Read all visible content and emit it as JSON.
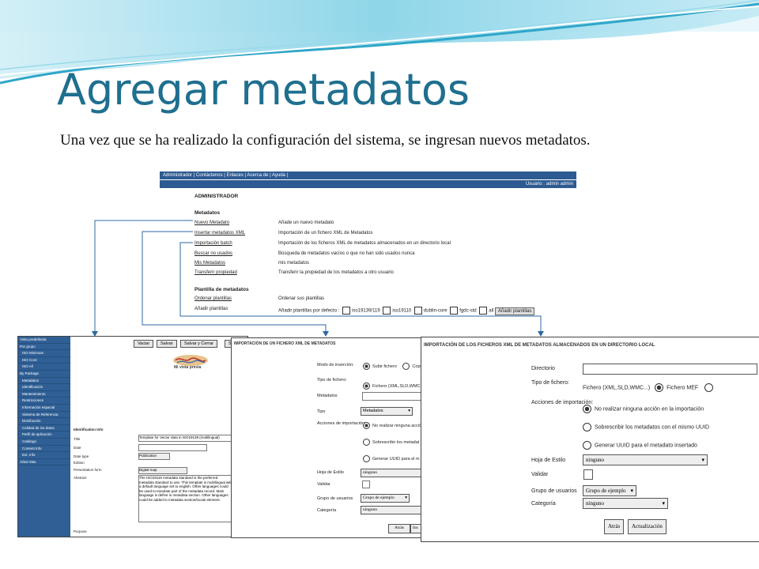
{
  "slide": {
    "title": "Agregar metadatos",
    "subtitle": "Una vez que se ha realizado la configuración del sistema, se ingresan nuevos metadatos."
  },
  "admin": {
    "menu": "Administrador | Contáctenos | Enlaces | Acerca de | Ayuda |",
    "user": "Usuario : admin admin",
    "heading": "ADMINISTRADOR",
    "section_metadatos": "Metadatos",
    "rows": [
      {
        "link": "Nuevo Metadato",
        "desc": "Añade un nuevo metadato"
      },
      {
        "link": "Insertar metadatos XML",
        "desc": "Importación de un fichero XML de Metadatos"
      },
      {
        "link": "Importación batch",
        "desc": "Importación de los ficheros XML de metadatos almacenados en un directorio local"
      },
      {
        "link": "Buscar no usados",
        "desc": "Búsqueda de metadatos vacíos o que no han sido usados nunca"
      },
      {
        "link": "Mis Metadatos",
        "desc": "mis metadatos"
      },
      {
        "link": "Transferir propiedad",
        "desc": "Transferir la propiedad de los metadatos a otro usuario"
      }
    ],
    "section_plantillas": "Plantilla de metadatos",
    "ordenar_link": "Ordenar plantillas",
    "ordenar_desc": "Ordenar sus plantillas",
    "anadir_label": "Añadir plantillas",
    "anadir_desc": "Añadir plantillas por defecto :",
    "templates": [
      "iso19139/119",
      "iso19110",
      "dublin-core",
      "fgdc-std",
      "all"
    ],
    "anadir_button": "Añadir plantillas"
  },
  "shotA": {
    "toolbar": [
      "Vaciar",
      "Salvar",
      "Salvar y Cerrar",
      "S"
    ],
    "sidebar": [
      "Vista predefinida",
      "Por grupo",
      "ISO Minimum",
      "ISO Core",
      "ISO All",
      "By Package",
      "Metadatos",
      "Identificación",
      "Mantenimiento",
      "Restricciones",
      "Información espacial",
      "Sistema de Referencia",
      "Distribución",
      "Calidad de los datos",
      "Perfil de aplicación",
      "Catálogo",
      "Content Info",
      "Ext. Info",
      "Árbol XML"
    ],
    "section": "Identification Info",
    "title_label": "Title",
    "title_value": "Template for Vector data in ISO19139 (multilingual)",
    "date_label": "Date",
    "date_type_label": "Date type",
    "date_type_value": "Publication",
    "edition_label": "Edition",
    "presentation_label": "Presentation form",
    "presentation_value": "Digital map",
    "abstract_label": "Abstract",
    "abstract_value": "The ISO19115 metadata standard is the preferred metadata standard to use. This template is multilingual with a default language set to english. Other languages could be used to translate part of the metadata record. Main language is define in metadata section. Other languages could be added to metadata section/locale element.",
    "purpose_label": "Purpose",
    "logo": "Mi vista previa"
  },
  "shotB": {
    "title": "IMPORTACIÓN DE UN FICHERO XML DE METADATOS",
    "modo_label": "Modo de inserción:",
    "modo_opt1": "Subir fichero",
    "modo_opt2": "Copi",
    "tipo_fichero_label": "Tipo de fichero:",
    "tipo_fichero_opt": "Fichero (XML,SLD,WMC",
    "metadatos_label": "Metadatos",
    "tipo_label": "Tipo",
    "tipo_value": "Metadatos",
    "acciones_label": "Acciones de importación:",
    "acc1": "No realizar ninguna acció",
    "acc2": "Sobrescribir los metadat",
    "acc3": "Generar UUID para el m",
    "hoja_label": "Hoja de Estilo",
    "hoja_value": "ninguno",
    "validar_label": "Validar",
    "grupo_label": "Grupo de usuarios",
    "grupo_value": "Grupo de ejemplo",
    "categoria_label": "Categoría",
    "categoria_value": "ninguno",
    "btn1": "Atrás",
    "btn2": "Ins"
  },
  "shotC": {
    "title": "IMPORTACIÓN DE LOS FICHEROS XML DE METADATOS ALMACENADOS EN UN DIRECTORIO LOCAL",
    "directorio_label": "Directorio",
    "tipo_label": "Tipo de fichero:",
    "tipo_opt1": "Fichero (XML,SLD,WMC...)",
    "tipo_opt2": "Fichero MEF",
    "acciones_label": "Acciones de importación:",
    "acc1": "No realizar ninguna acción en la importación",
    "acc2": "Sobrescribir los metadatos con el mismo UUID",
    "acc3": "Generar UUID para el metadato insertado",
    "hoja_label": "Hoja de Estilo",
    "hoja_value": "ninguno",
    "validar_label": "Validar",
    "grupo_label": "Grupo de usuarios",
    "grupo_value": "Grupo de ejemplo",
    "categoria_label": "Categoría",
    "categoria_value": "ninguno",
    "btn_atras": "Atrás",
    "btn_actualizacion": "Actualización"
  }
}
